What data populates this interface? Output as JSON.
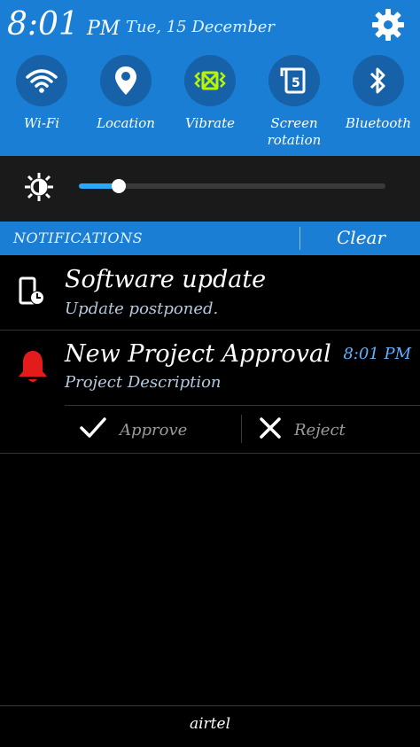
{
  "status": {
    "time": "8:01",
    "ampm": "PM",
    "date": "Tue, 15 December"
  },
  "quick_settings": [
    {
      "label": "Wi-Fi",
      "icon": "wifi-icon"
    },
    {
      "label": "Location",
      "icon": "location-icon"
    },
    {
      "label": "Vibrate",
      "icon": "vibrate-icon"
    },
    {
      "label": "Screen rotation",
      "icon": "screen-rotation-icon"
    },
    {
      "label": "Bluetooth",
      "icon": "bluetooth-icon"
    }
  ],
  "brightness": {
    "level": 0.13,
    "icon": "brightness-icon"
  },
  "notifications_header": {
    "title": "NOTIFICATIONS",
    "clear_label": "Clear"
  },
  "notifications": [
    {
      "title": "Software update",
      "subtitle": "Update postponed.",
      "icon": "software-update-icon"
    },
    {
      "title": "New Project Approval",
      "subtitle": "Project Description",
      "time": "8:01 PM",
      "icon": "bell-icon",
      "actions": [
        {
          "label": "Approve",
          "icon": "check-icon"
        },
        {
          "label": "Reject",
          "icon": "close-icon"
        }
      ]
    }
  ],
  "carrier": "airtel",
  "colors": {
    "header_blue": "#1a7fd4",
    "toggle_bg": "#1661a8",
    "accent_blue": "#29a8ff",
    "alert_red": "#e31b1b",
    "vibrate_green": "#b8f500"
  }
}
